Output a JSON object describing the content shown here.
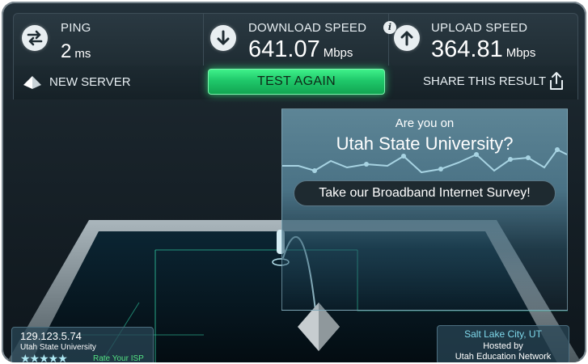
{
  "stats": {
    "ping": {
      "label": "PING",
      "value": "2",
      "unit": "ms",
      "icon": "exchange-arrows-icon"
    },
    "download": {
      "label": "DOWNLOAD SPEED",
      "value": "641.07",
      "unit": "Mbps",
      "icon": "arrow-down-icon"
    },
    "upload": {
      "label": "UPLOAD SPEED",
      "value": "364.81",
      "unit": "Mbps",
      "icon": "arrow-up-icon"
    },
    "info_glyph": "i"
  },
  "actions": {
    "new_server": "NEW SERVER",
    "test_again": "TEST AGAIN",
    "share": "SHARE THIS RESULT"
  },
  "isp_prompt": {
    "question": "Are you on",
    "isp": "Utah State University?",
    "survey_button": "Take our Broadband Internet Survey!"
  },
  "client": {
    "ip": "129.123.5.74",
    "isp": "Utah State University",
    "stars": "★★★★★",
    "rate_label": "Rate Your ISP"
  },
  "server": {
    "city": "Salt Lake City, UT",
    "hosted_label": "Hosted by",
    "network": "Utah Education Network"
  },
  "colors": {
    "accent_green": "#1fc86a",
    "panel_teal": "#4a7285",
    "background": "#1a252c"
  }
}
